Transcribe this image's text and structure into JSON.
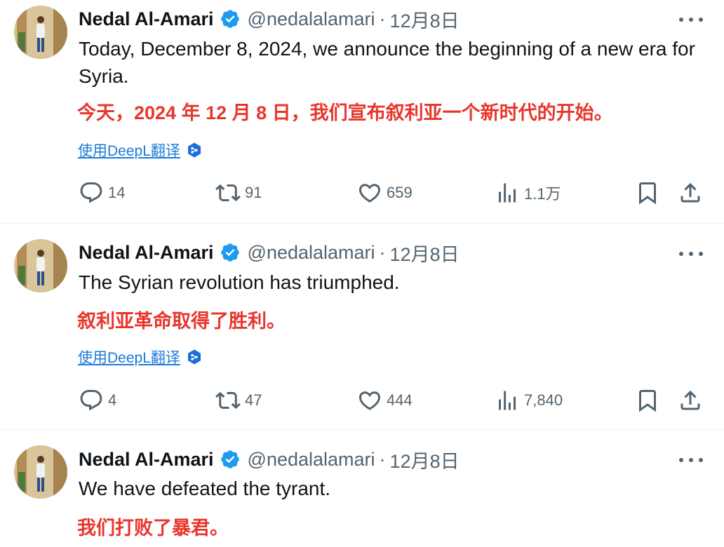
{
  "tweets": [
    {
      "author": "Nedal Al-Amari",
      "handle": "@nedalalamari",
      "separator": "·",
      "date": "12月8日",
      "text": "Today, December 8, 2024, we announce the beginning of a new era for Syria.",
      "translation": "今天，2024 年 12 月 8 日，我们宣布叙利亚一个新时代的开始。",
      "translate_label": "使用DeepL翻译",
      "replies": "14",
      "reposts": "91",
      "likes": "659",
      "views": "1.1万"
    },
    {
      "author": "Nedal Al-Amari",
      "handle": "@nedalalamari",
      "separator": "·",
      "date": "12月8日",
      "text": "The Syrian revolution has triumphed.",
      "translation": "叙利亚革命取得了胜利。",
      "translate_label": "使用DeepL翻译",
      "replies": "4",
      "reposts": "47",
      "likes": "444",
      "views": "7,840"
    },
    {
      "author": "Nedal Al-Amari",
      "handle": "@nedalalamari",
      "separator": "·",
      "date": "12月8日",
      "text": "We have defeated the tyrant.",
      "translation": "我们打败了暴君。"
    }
  ],
  "colors": {
    "text": "#0f1419",
    "secondary": "#536471",
    "verified": "#1d9bf0",
    "translation": "#e8362c",
    "link": "#1d7bd9",
    "divider": "#eff3f4"
  },
  "icons": [
    "verified-badge-icon",
    "more-icon",
    "deepl-icon",
    "reply-icon",
    "repost-icon",
    "like-icon",
    "views-icon",
    "bookmark-icon",
    "share-icon"
  ]
}
